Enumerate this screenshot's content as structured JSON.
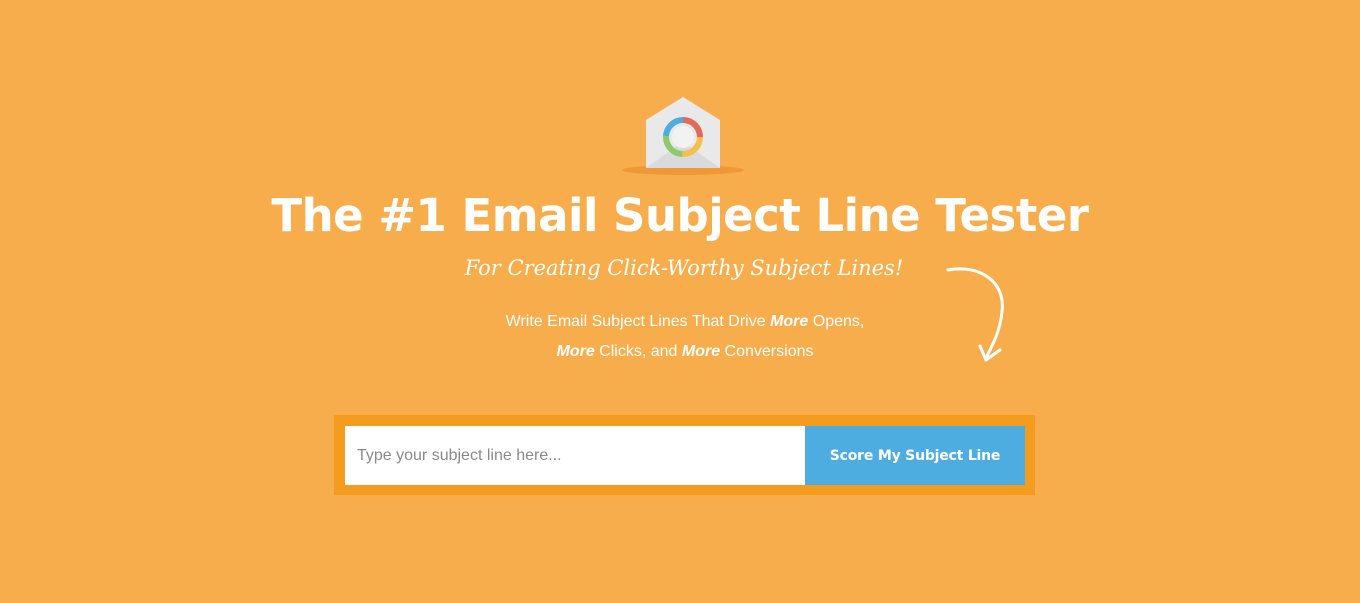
{
  "hero": {
    "logo_icon": "envelope-donut-icon",
    "title": "The #1 Email Subject Line Tester",
    "tagline": "For Creating Click-Worthy Subject Lines!",
    "subcopy": {
      "line1_pre": "Write Email Subject Lines That Drive ",
      "emphasis_1": "More",
      "line1_post": " Opens,",
      "emphasis_2": "More",
      "line2_mid": " Clicks, and ",
      "emphasis_3": "More",
      "line2_post": " Conversions"
    },
    "arrow_icon": "curved-arrow-down-icon"
  },
  "form": {
    "input_value": "",
    "input_placeholder": "Type your subject line here...",
    "button_label": "Score My Subject Line"
  },
  "colors": {
    "background": "#f8ad4d",
    "form_frame": "#f39c1e",
    "button": "#4eade0",
    "text": "#ffffff"
  }
}
